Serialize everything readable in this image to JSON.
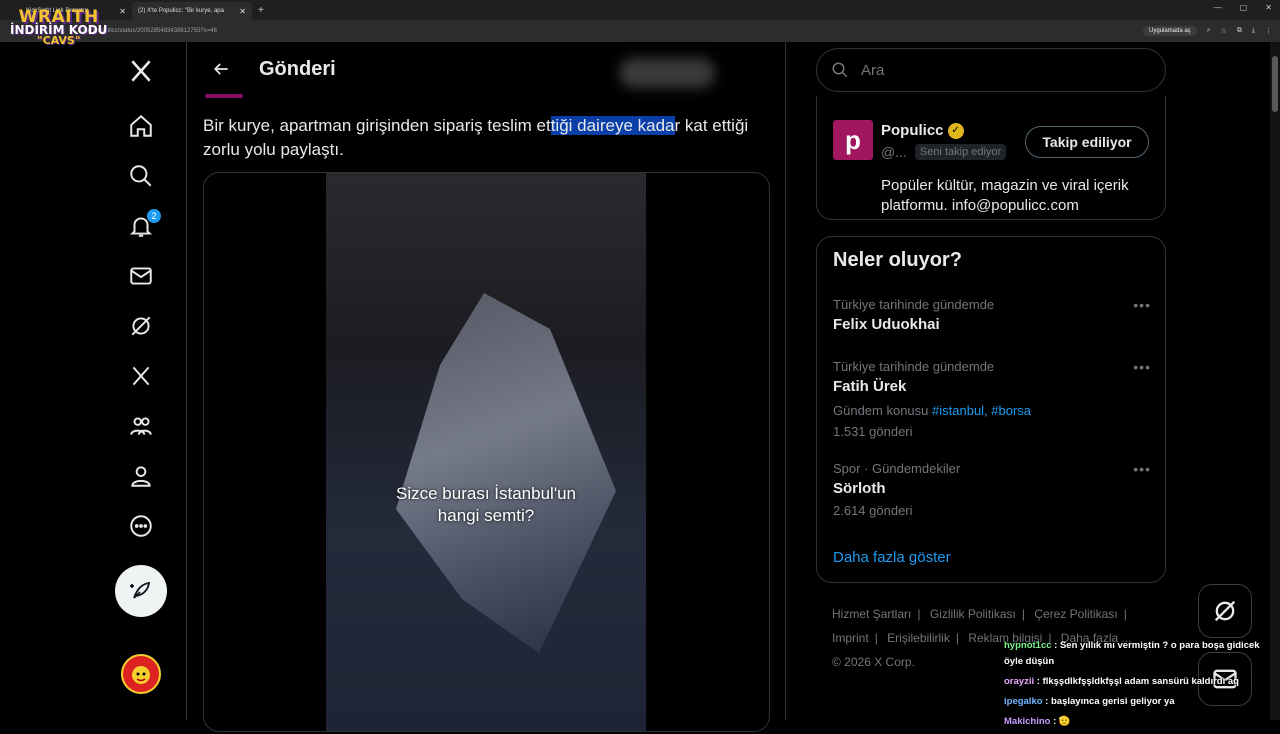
{
  "browser": {
    "tabs": [
      {
        "title": "KickSight Link Detector"
      },
      {
        "title": "(2) X'te Populicc: \"Bir kurye, apa"
      }
    ],
    "url": "x.com/populicc/status/2005285483438612755?s=46",
    "open_in_app": "Uygulamada aç"
  },
  "overlay": {
    "brand": "WRAITH",
    "code_label": "İNDİRİM KODU",
    "code": "\"CAVS\""
  },
  "nav": {
    "notifications_badge": "2"
  },
  "main": {
    "title": "Gönderi",
    "post_text_before": "Bir kurye, apartman girişinden sipariş teslim et",
    "post_text_highlight": "tiği daireye kada",
    "post_text_after": "r kat ettiği zorlu yolu paylaştı.",
    "video_caption_line1": "Sizce burası İstanbul'un",
    "video_caption_line2": "hangi semti?"
  },
  "right": {
    "search_placeholder": "Ara",
    "user": {
      "logo_letter": "p",
      "name": "Populicc",
      "handle": "@...",
      "follows_you": "Seni takip ediyor",
      "follow_button": "Takip ediliyor",
      "bio": "Popüler kültür, magazin ve viral içerik platformu. info@populicc.com"
    },
    "trends_title": "Neler oluyor?",
    "trends": [
      {
        "meta": "Türkiye tarihinde gündemde",
        "name": "Felix Uduokhai"
      },
      {
        "meta": "Türkiye tarihinde gündemde",
        "name": "Fatih Ürek",
        "sub_prefix": "Gündem konusu",
        "sub_links": "#istanbul, #borsa",
        "count": "1.531 gönderi"
      },
      {
        "meta": "Spor · Gündemdekiler",
        "name": "Sörloth",
        "count": "2.614 gönderi"
      }
    ],
    "show_more": "Daha fazla göster",
    "footer": {
      "links": [
        "Hizmet Şartları",
        "Gizlilik Politikası",
        "Çerez Politikası",
        "Imprint",
        "Erişilebilirlik",
        "Reklam bilgisi",
        "Daha fazla ..."
      ],
      "copyright": "© 2026 X Corp."
    }
  },
  "chat": [
    {
      "user": "hypnot1cc",
      "text": "Sen yıllık mı vermiştin ? o para boşa gidicek öyle düşün"
    },
    {
      "user": "orayzii",
      "text": "flkşşdlkfşşldkfşşl adam sansürü kaldırdı aq"
    },
    {
      "user": "ipegalko",
      "text": "başlayınca gerisi geliyor ya"
    },
    {
      "user": "Makichino",
      "text": "🫡"
    }
  ]
}
